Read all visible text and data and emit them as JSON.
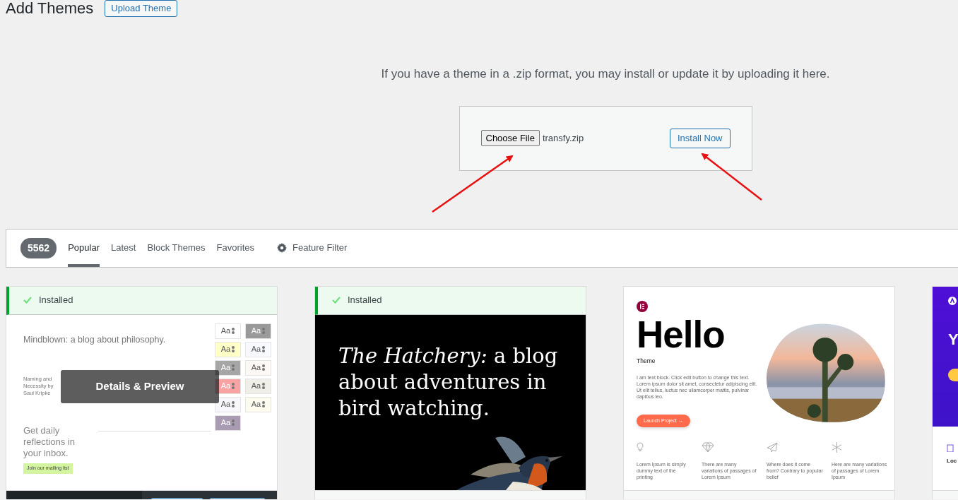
{
  "header": {
    "title": "Add Themes",
    "upload_button": "Upload Theme"
  },
  "upload": {
    "description": "If you have a theme in a .zip format, you may install or update it by uploading it here.",
    "file_button": "Choose File",
    "file_name": "transfy.zip",
    "install_button": "Install Now"
  },
  "filter_bar": {
    "count": "5562",
    "tabs": [
      {
        "label": "Popular",
        "selected": true
      },
      {
        "label": "Latest",
        "selected": false
      },
      {
        "label": "Block Themes",
        "selected": false
      },
      {
        "label": "Favorites",
        "selected": false
      }
    ],
    "feature_filter": "Feature Filter"
  },
  "themes": [
    {
      "installed": true,
      "installed_label": "Installed",
      "hovered": true,
      "overlay_label": "Details & Preview",
      "preview": {
        "kind": "blog_grid",
        "title": "Mindblown: a blog about philosophy.",
        "posts": [
          {
            "title": "Naming and Necessity by Saul Kripke"
          }
        ],
        "swatches": [
          {
            "label": "Aa",
            "color": "#ffffff"
          },
          {
            "label": "Aa",
            "color": "#9a9a9a"
          },
          {
            "label": "Aa",
            "color": "#ffffc8"
          },
          {
            "label": "Aa",
            "color": "#f8f8ff"
          },
          {
            "label": "Aa",
            "color": "#a6a6a6"
          },
          {
            "label": "Aa",
            "color": "#fbf8f6"
          },
          {
            "label": "Aa",
            "color": "#f7a3a3"
          },
          {
            "label": "Aa",
            "color": "#efefe7"
          },
          {
            "label": "Aa",
            "color": "#f6f6fb"
          },
          {
            "label": "Aa",
            "color": "#fdfbee"
          },
          {
            "label": "Aa",
            "color": "#a99cb2"
          }
        ],
        "subscribe": "Get daily reflections in your inbox.",
        "subscribe_button": "Join our mailing list"
      }
    },
    {
      "installed": true,
      "installed_label": "Installed",
      "hovered": false,
      "preview": {
        "kind": "dark_blog",
        "headline": "*The Hatchery:* a blog about adventures in bird watching."
      }
    },
    {
      "installed": false,
      "hovered": false,
      "preview": {
        "kind": "hello",
        "title": "Hello",
        "subtitle": "Theme",
        "text": "I am text block. Click edit button to change this text. Lorem ipsum dolor sit amet, consectetur adipiscing elit. Ut elit tellus, luctus nec ullamcorper mattis, pulvinar dapibus leo.",
        "button": "Launch Project →",
        "features": [
          "Lorem Ipsum is simply dummy text of the printing",
          "There are many variations of passages of Lorem Ipsum",
          "Where does it come from? Contrary to popular belief",
          "Here are many variations of passages of Lorem Ipsum"
        ]
      }
    },
    {
      "installed": false,
      "hovered": false,
      "preview": {
        "kind": "purple",
        "headline": "Y",
        "feature": "Loc"
      }
    }
  ]
}
